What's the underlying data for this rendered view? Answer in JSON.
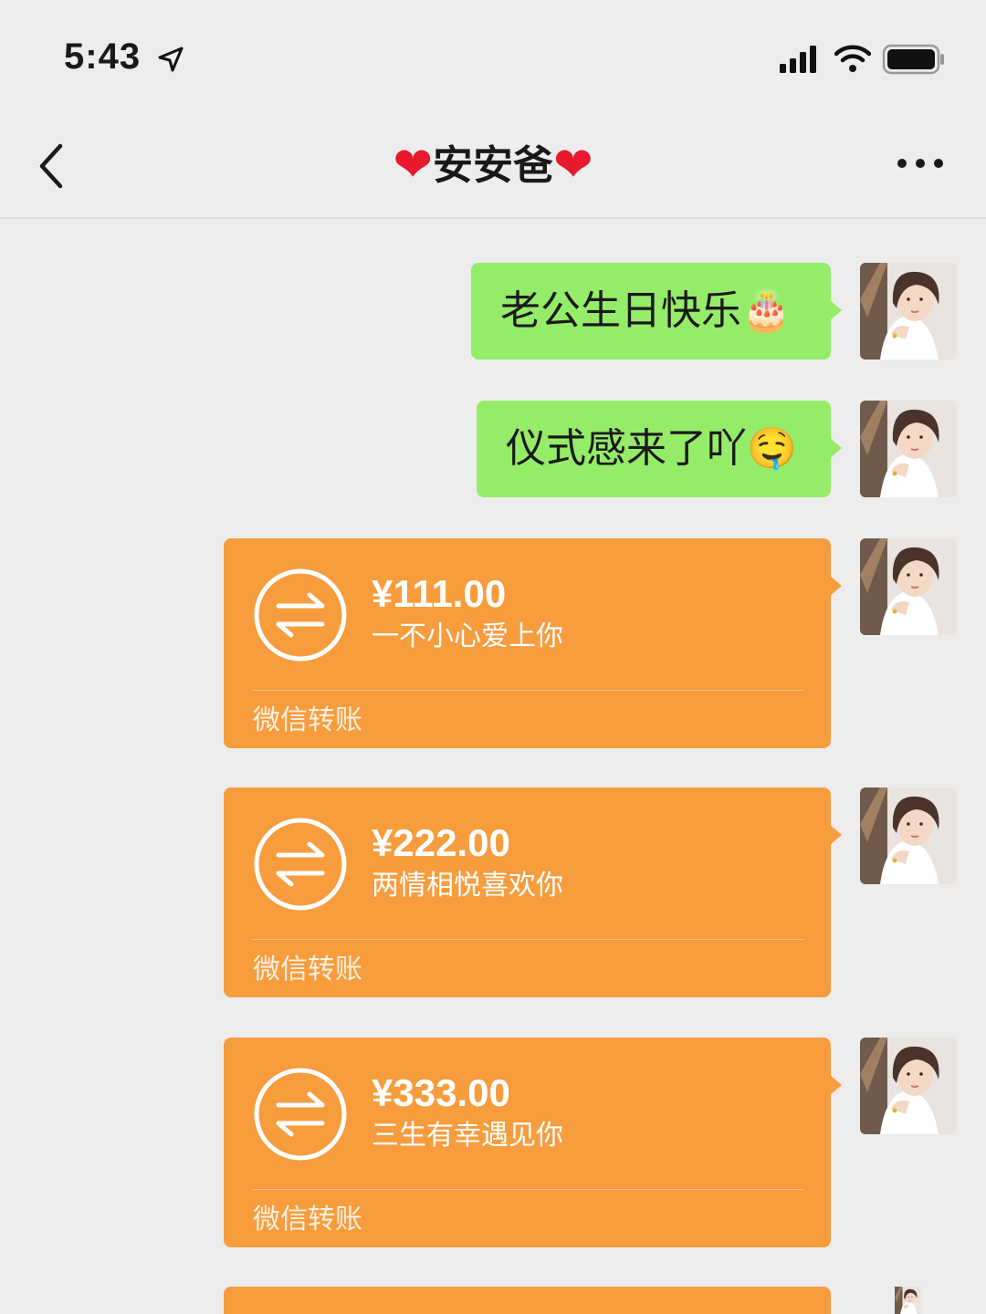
{
  "status_bar": {
    "time": "5:43"
  },
  "nav": {
    "title": "安安爸"
  },
  "messages": [
    {
      "type": "text",
      "text": "老公生日快乐",
      "emoji": "🎂"
    },
    {
      "type": "text",
      "text": "仪式感来了吖",
      "emoji": "🤤"
    },
    {
      "type": "transfer",
      "amount": "¥111.00",
      "note": "一不小心爱上你",
      "brand": "微信转账"
    },
    {
      "type": "transfer",
      "amount": "¥222.00",
      "note": "两情相悦喜欢你",
      "brand": "微信转账"
    },
    {
      "type": "transfer",
      "amount": "¥333.00",
      "note": "三生有幸遇见你",
      "brand": "微信转账"
    }
  ],
  "colors": {
    "green_bubble": "#95ec69",
    "transfer_bubble": "#f79d3e",
    "background": "#ededed",
    "heart": "#e8192c"
  }
}
